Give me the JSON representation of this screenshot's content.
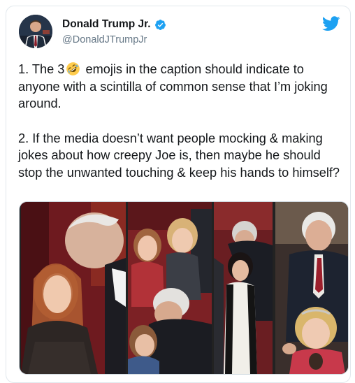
{
  "tweet": {
    "author": {
      "display_name": "Donald Trump Jr.",
      "handle": "@DonaldJTrumpJr",
      "verified": true,
      "avatar_icon": "profile-photo"
    },
    "brand_icon": "twitter-bird-icon",
    "brand_color": "#1da1f2",
    "paragraph_1_before": "1. The 3",
    "emoji_icon": "rolling-on-floor-laughing-emoji",
    "paragraph_1_after": " emojis in the caption should indicate to anyone with a scintilla of common sense that I’m joking around.",
    "paragraph_2": "2. If the media doesn’t want people mocking & making jokes about how creepy Joe is, then maybe he should stop the unwanted touching & keep his hands to himself?",
    "media": {
      "photo_count": 4
    }
  },
  "colors": {
    "text": "#14171a",
    "secondary_text": "#657786",
    "border": "#e1e8ed"
  }
}
